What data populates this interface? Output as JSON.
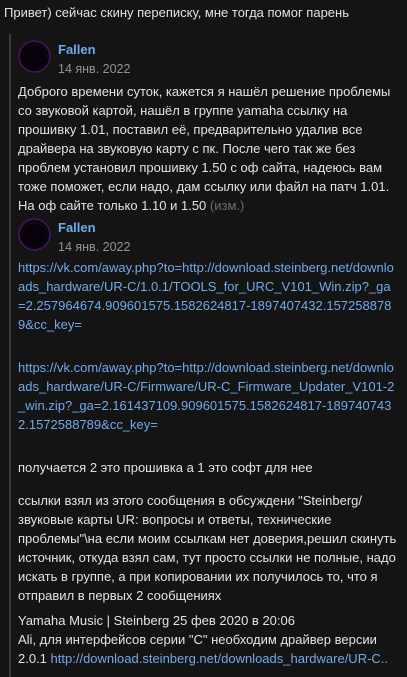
{
  "intro_text": "Привет) сейчас скину переписку, мне тогда помог парень",
  "message1": {
    "author": "Fallen",
    "date": "14 янв. 2022",
    "text": "Доброго времени суток, кажется я нашёл решение проблемы со звуковой картой, нашёл в группе yamaha ссылку на прошивку 1.01, поставил её, предварительно удалив все драйвера на звуковую карту с пк. После чего так же без проблем установил прошивку 1.50 с оф сайта, надеюсь вам тоже поможет, если надо, дам ссылку или файл на патч 1.01. На оф сайте только 1.10 и 1.50",
    "edited_label": "(изм.)"
  },
  "message2": {
    "author": "Fallen",
    "date": "14 янв. 2022",
    "link1": "https://vk.com/away.php?to=http://download.steinberg.net/downloads_hardware/UR-C/1.0.1/TOOLS_for_URC_V101_Win.zip?_ga=2.257964674.909601575.1582624817-1897407432.1572588789&cc_key=",
    "link2": "https://vk.com/away.php?to=http://download.steinberg.net/downloads_hardware/UR-C/Firmware/UR-C_Firmware_Updater_V101-2_win.zip?_ga=2.161437109.909601575.1582624817-1897407432.1572588789&cc_key=",
    "text1": "получается 2 это прошивка а 1 это софт для нее",
    "text2": "ссылки взял из этого сообщения в обсуждени \"Steinberg/звуковые карты UR: вопросы и ответы, технические проблемы\"\\на если моим ссылкам нет доверия,решил скинуть источник, откуда взял сам, тут просто ссылки не полные, надо искать в группе, а при копировании их получилось то, что я отправил в первых 2 сообщениях",
    "source_header": "Yamaha Music | Steinberg 25 фев 2020 в 20:06",
    "source_text": "Ali, для интерфейсов серии \"С\" необходим драйвер версии 2.0.1",
    "source_link": "http://download.steinberg.net/downloads_hardware/UR-C.."
  },
  "colors": {
    "background": "#141414",
    "text": "#e1e3e6",
    "link": "#71aaeb",
    "muted": "#939393"
  }
}
